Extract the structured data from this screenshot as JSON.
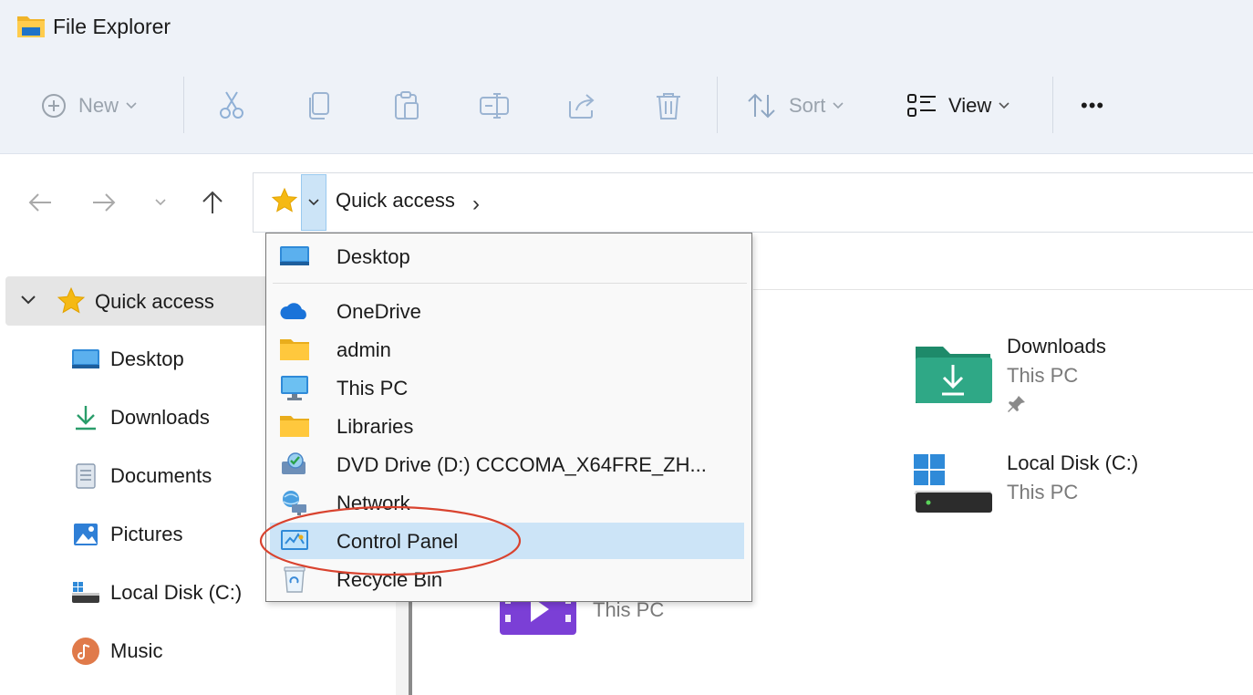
{
  "window": {
    "title": "File Explorer",
    "app_icon": "folder-icon"
  },
  "toolbar": {
    "new_label": "New",
    "sort_label": "Sort",
    "view_label": "View",
    "more_label": "•••",
    "icons": [
      "new-icon",
      "cut-icon",
      "copy-icon",
      "paste-icon",
      "rename-icon",
      "share-icon",
      "delete-icon",
      "sort-icon",
      "view-icon"
    ]
  },
  "address": {
    "current": "Quick access",
    "icon": "star-icon",
    "separator": "›"
  },
  "dropdown": {
    "items": [
      {
        "label": "Desktop",
        "icon": "desktop-icon"
      },
      {
        "label": "OneDrive",
        "icon": "onedrive-icon"
      },
      {
        "label": "admin",
        "icon": "user-folder-icon"
      },
      {
        "label": "This PC",
        "icon": "this-pc-icon"
      },
      {
        "label": "Libraries",
        "icon": "libraries-icon"
      },
      {
        "label": "DVD Drive (D:) CCCOMA_X64FRE_ZH...",
        "icon": "dvd-drive-icon"
      },
      {
        "label": "Network",
        "icon": "network-icon"
      },
      {
        "label": "Control Panel",
        "icon": "control-panel-icon",
        "selected": true
      },
      {
        "label": "Recycle Bin",
        "icon": "recycle-bin-icon"
      }
    ]
  },
  "nav": {
    "quick_access": "Quick access",
    "items": [
      {
        "label": "Desktop",
        "icon": "desktop-icon"
      },
      {
        "label": "Downloads",
        "icon": "downloads-icon"
      },
      {
        "label": "Documents",
        "icon": "documents-icon"
      },
      {
        "label": "Pictures",
        "icon": "pictures-icon"
      },
      {
        "label": "Local Disk (C:)",
        "icon": "local-disk-icon"
      },
      {
        "label": "Music",
        "icon": "music-icon"
      }
    ]
  },
  "content": {
    "tiles": [
      {
        "name": "Downloads",
        "location": "This PC",
        "pinned": true
      },
      {
        "name": "Local Disk (C:)",
        "location": "This PC"
      },
      {
        "name": "",
        "location": "This PC"
      }
    ]
  },
  "colors": {
    "accent": "#0067c0",
    "selection": "#cce4f7",
    "annotation": "#d9432f"
  }
}
